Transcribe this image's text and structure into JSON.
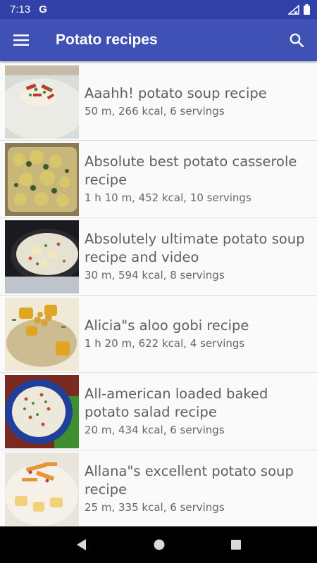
{
  "status_bar": {
    "time": "7:13",
    "g_label": "G"
  },
  "app_bar": {
    "title": "Potato recipes",
    "menu_icon": "hamburger-menu-icon",
    "search_icon": "search-icon"
  },
  "recipes": [
    {
      "title": "Aaahh! potato soup recipe",
      "meta": "50 m, 266 kcal, 6 servings"
    },
    {
      "title": "Absolute best potato casserole recipe",
      "meta": "1 h 10 m, 452 kcal, 10 servings"
    },
    {
      "title": "Absolutely ultimate potato soup recipe and video",
      "meta": "30 m, 594 kcal, 8 servings"
    },
    {
      "title": "Alicia\"s aloo gobi recipe",
      "meta": "1 h 20 m, 622 kcal, 4 servings"
    },
    {
      "title": "All-american loaded baked potato salad recipe",
      "meta": "20 m, 434 kcal, 6 servings"
    },
    {
      "title": "Allana\"s excellent potato soup recipe",
      "meta": "25 m, 335 kcal, 6 servings"
    }
  ],
  "nav_bar": {
    "back_icon": "back-triangle-icon",
    "home_icon": "home-circle-icon",
    "recents_icon": "recents-square-icon"
  },
  "colors": {
    "app_bar": "#3f51b5",
    "status_bar": "#3141a8",
    "background": "#fafafa"
  }
}
